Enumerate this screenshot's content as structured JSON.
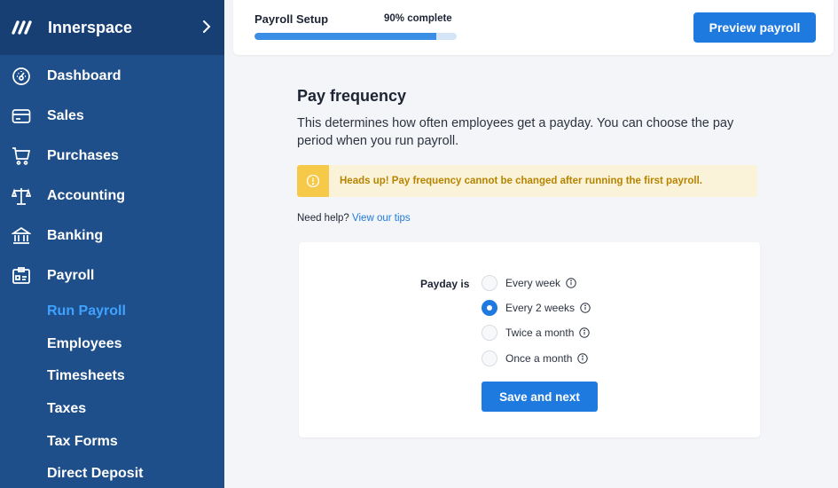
{
  "sidebar": {
    "brand": "Innerspace",
    "nav": [
      {
        "label": "Dashboard",
        "icon": "dashboard-gauge-icon"
      },
      {
        "label": "Sales",
        "icon": "card-icon"
      },
      {
        "label": "Purchases",
        "icon": "cart-icon"
      },
      {
        "label": "Accounting",
        "icon": "scales-icon"
      },
      {
        "label": "Banking",
        "icon": "bank-icon"
      },
      {
        "label": "Payroll",
        "icon": "id-badge-icon"
      }
    ],
    "payroll_sub": [
      {
        "label": "Run Payroll",
        "active": true
      },
      {
        "label": "Employees"
      },
      {
        "label": "Timesheets"
      },
      {
        "label": "Taxes"
      },
      {
        "label": "Tax Forms"
      },
      {
        "label": "Direct Deposit"
      }
    ]
  },
  "header": {
    "title": "Payroll Setup",
    "progress_text": "90% complete",
    "progress_value": 0.9,
    "preview_button": "Preview payroll"
  },
  "main": {
    "title": "Pay frequency",
    "description": "This determines how often employees get a payday. You can choose the pay period when you run payroll.",
    "alert": "Heads up! Pay frequency cannot be changed after running the first payroll.",
    "help_prefix": "Need help?",
    "help_link": "View our tips",
    "payday_label": "Payday is",
    "options": [
      {
        "label": "Every week",
        "checked": false
      },
      {
        "label": "Every 2 weeks",
        "checked": true
      },
      {
        "label": "Twice a month",
        "checked": false
      },
      {
        "label": "Once a month",
        "checked": false
      }
    ],
    "save_button": "Save and next"
  },
  "colors": {
    "sidebar_bg": "#1f4f8a",
    "brand_bg": "#173f74",
    "accent": "#1f7ae0",
    "active_nav": "#3fa2ff",
    "alert_bg": "#fbf3d9",
    "alert_icon": "#f7c948"
  }
}
